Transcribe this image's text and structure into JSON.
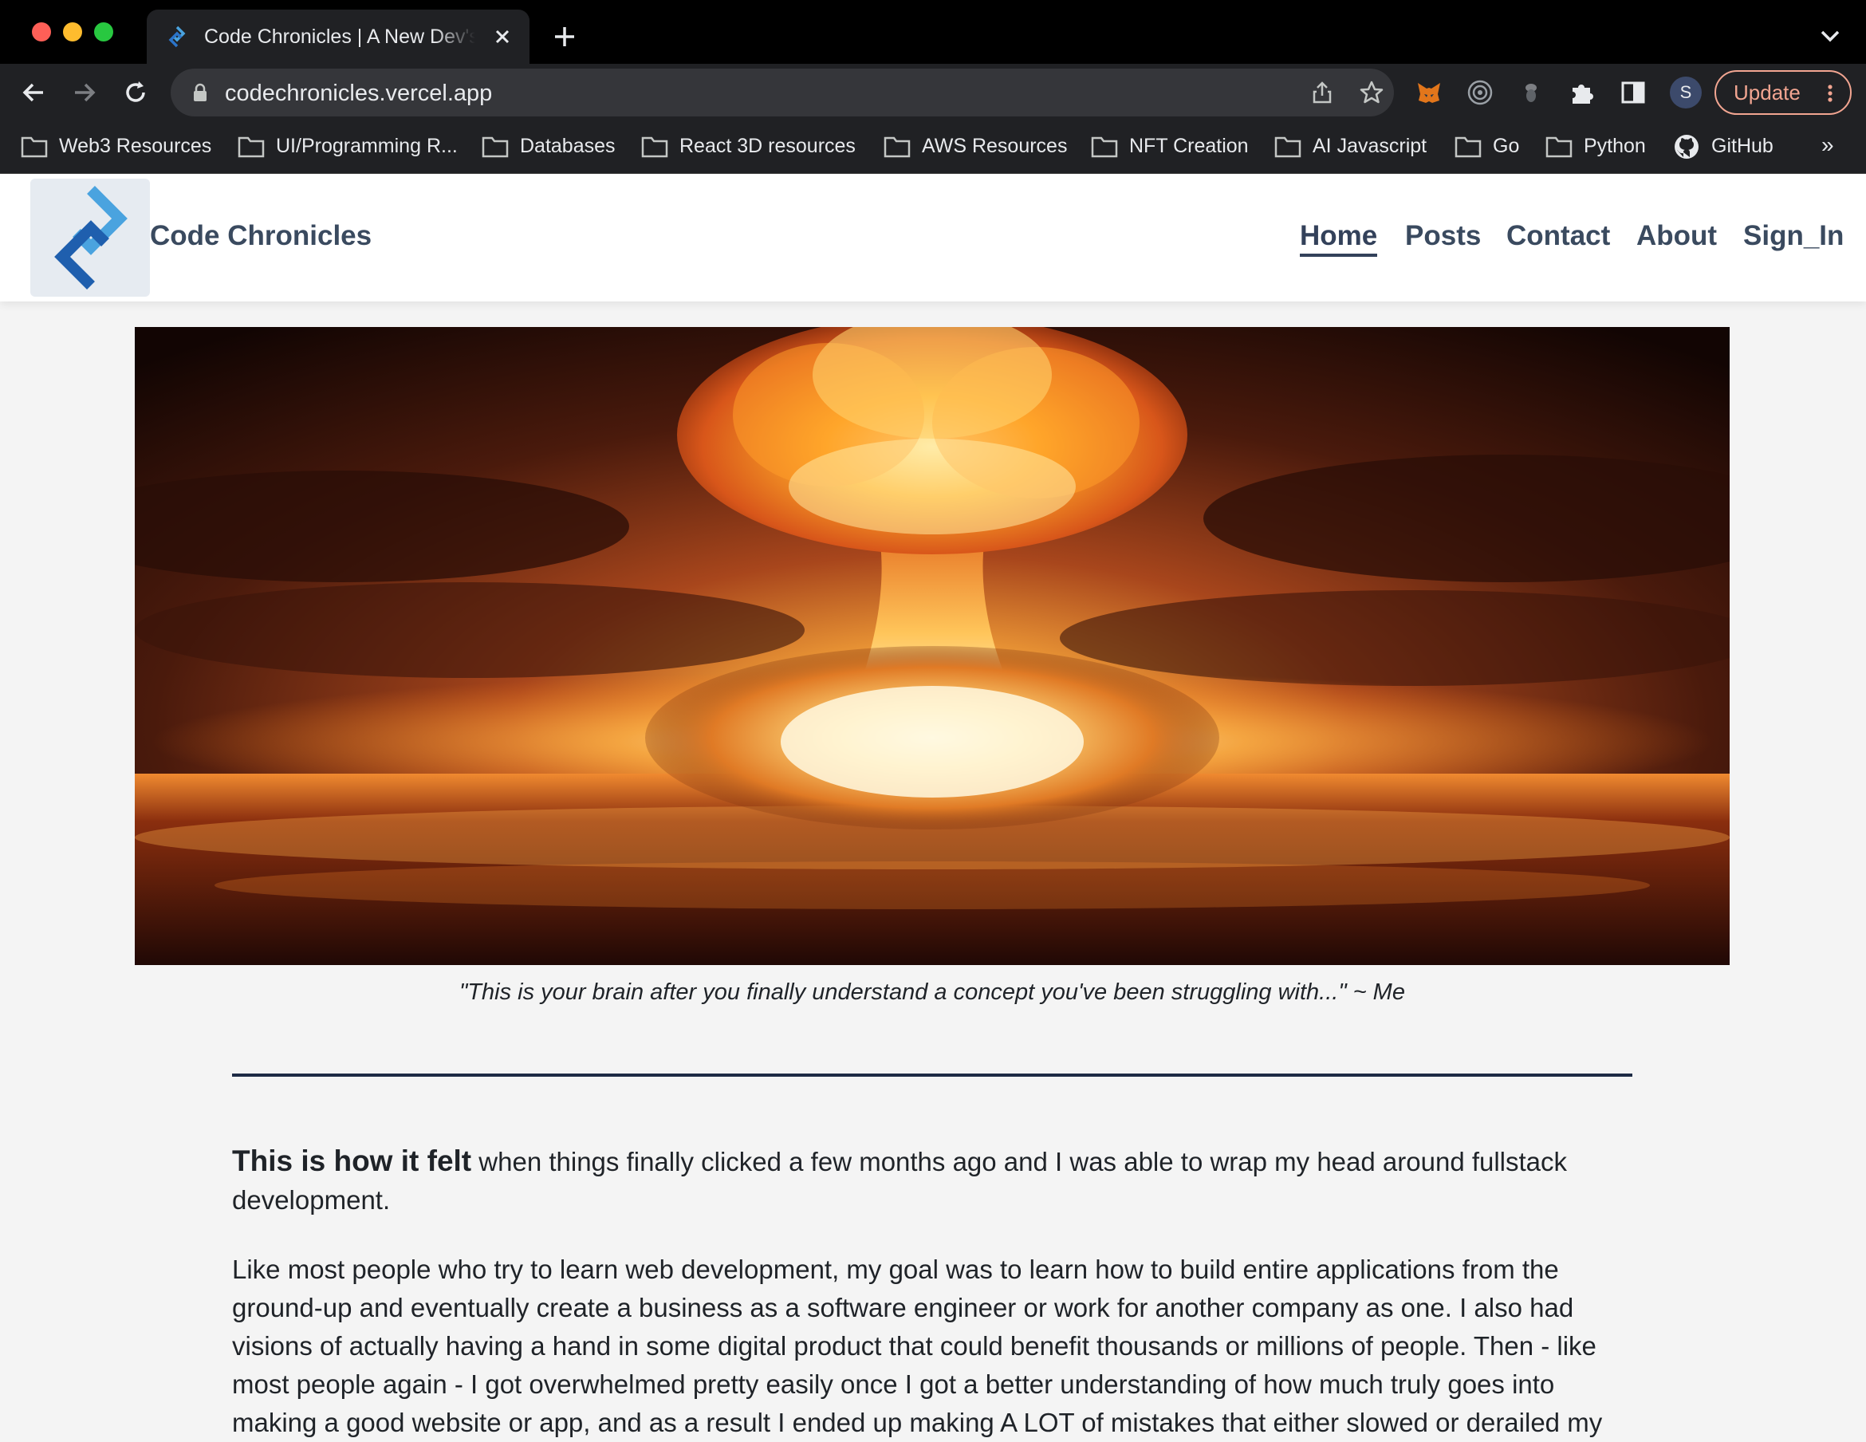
{
  "browser": {
    "tab": {
      "title": "Code Chronicles | A New Dev's"
    },
    "address_bar": {
      "url": "codechronicles.vercel.app"
    },
    "profile_initial": "S",
    "update_label": "Update",
    "bookmarks": [
      {
        "label": "Web3 Resources",
        "icon": "folder-icon"
      },
      {
        "label": "UI/Programming R...",
        "icon": "folder-icon"
      },
      {
        "label": "Databases",
        "icon": "folder-icon"
      },
      {
        "label": "React 3D resources",
        "icon": "folder-icon"
      },
      {
        "label": "AWS Resources",
        "icon": "folder-icon"
      },
      {
        "label": "NFT Creation",
        "icon": "folder-icon"
      },
      {
        "label": "AI Javascript",
        "icon": "folder-icon"
      },
      {
        "label": "Go",
        "icon": "folder-icon"
      },
      {
        "label": "Python",
        "icon": "folder-icon"
      },
      {
        "label": "GitHub",
        "icon": "github-icon"
      }
    ],
    "bookmarks_more": "»",
    "colors": {
      "chrome_bg": "#202124",
      "tab_strip": "#000000",
      "update_accent": "#f2a591"
    }
  },
  "site": {
    "title": "Code Chronicles",
    "nav": {
      "home": "Home",
      "posts": "Posts",
      "contact": "Contact",
      "about": "About",
      "sign_in": "Sign_In"
    },
    "active_nav": "Home",
    "colors": {
      "nav_text": "#3a4a5f",
      "logo_blue_light": "#4aa3df",
      "logo_blue_dark": "#1f5fae",
      "divider": "#1e2b45"
    }
  },
  "article": {
    "hero_image_alt": "nuclear-explosion-image",
    "caption": "\"This is your brain after you finally understand a concept you've been struggling with...\" ~ Me",
    "p1_lead": "This is how it felt",
    "p1_rest": " when things finally clicked a few months ago and I was able to wrap my head around fullstack development.",
    "p2": "Like most people who try to learn web development, my goal was to learn how to build entire applications from the ground-up and eventually create a business as a software engineer or work for another company as one. I also had visions of actually having a hand in some digital product that could benefit thousands or millions of people. Then - like most people again - I got overwhelmed pretty easily once I got a better understanding of how much truly goes into making a good website or app, and as a result I ended up making A LOT of mistakes that either slowed or derailed my"
  }
}
